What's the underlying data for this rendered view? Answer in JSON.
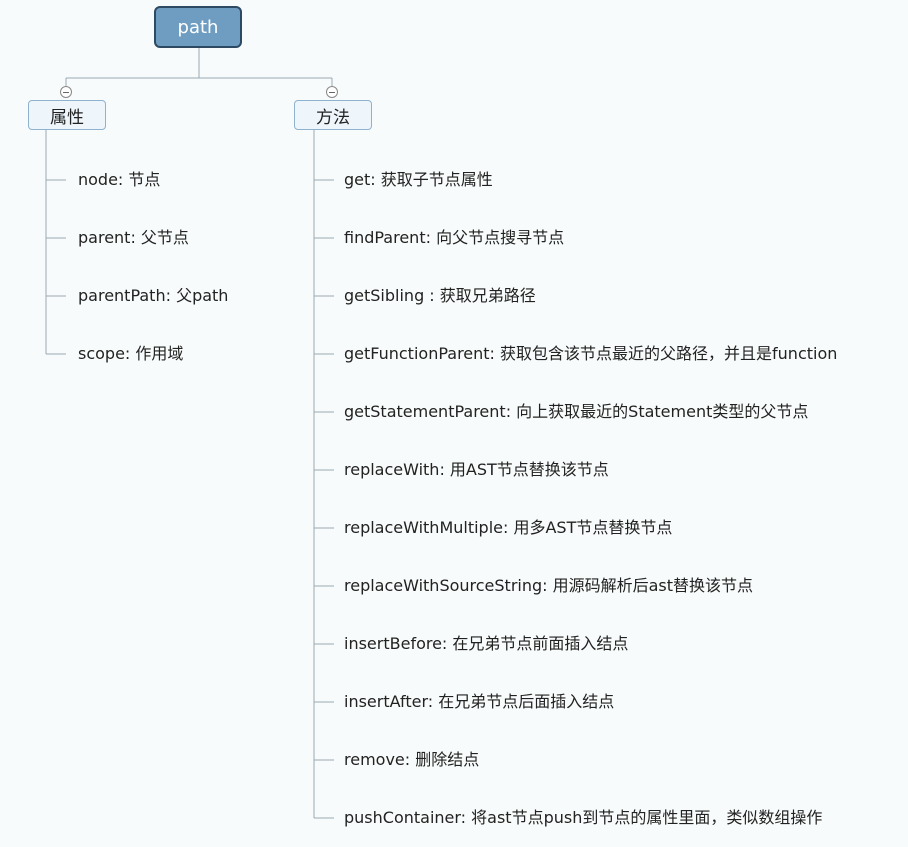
{
  "root": {
    "label": "path"
  },
  "branches": [
    {
      "label": "属性",
      "items": [
        "node: 节点",
        "parent: 父节点",
        "parentPath:  父path",
        "scope: 作用域"
      ]
    },
    {
      "label": "方法",
      "items": [
        "get: 获取子节点属性",
        "findParent: 向父节点搜寻节点",
        "getSibling  : 获取兄弟路径",
        "getFunctionParent: 获取包含该节点最近的父路径，并且是function",
        "getStatementParent:  向上获取最近的Statement类型的父节点",
        "replaceWith: 用AST节点替换该节点",
        "replaceWithMultiple: 用多AST节点替换节点",
        "replaceWithSourceString: 用源码解析后ast替换该节点",
        "insertBefore: 在兄弟节点前面插入结点",
        "insertAfter: 在兄弟节点后面插入结点",
        "remove: 删除结点",
        "pushContainer: 将ast节点push到节点的属性里面，类似数组操作"
      ]
    }
  ],
  "colors": {
    "root_fill": "#6f9dc2",
    "root_border": "#2d4a62",
    "branch_fill": "#eef5fb",
    "branch_border": "#8fb3cf",
    "line": "#9aa8b2"
  }
}
